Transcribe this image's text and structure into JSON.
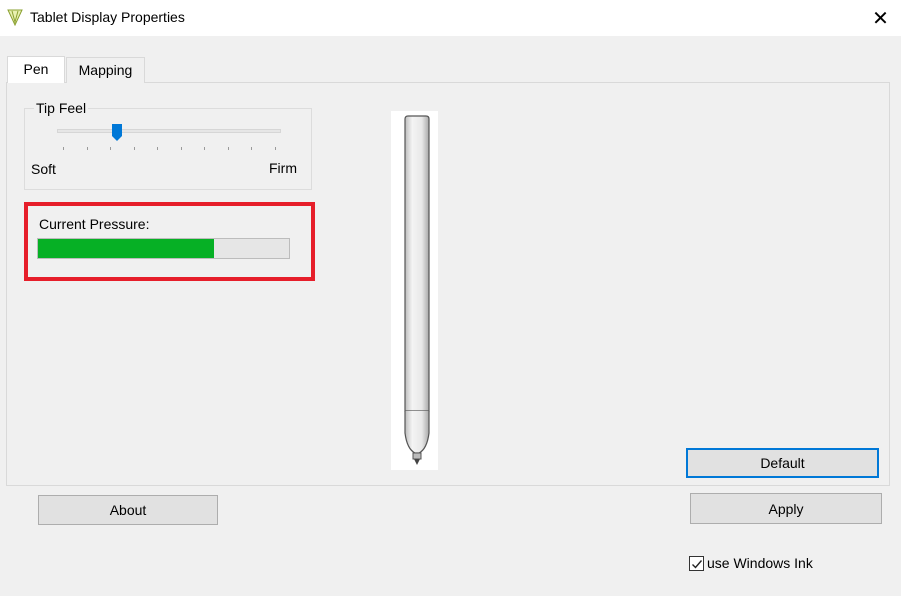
{
  "window": {
    "title": "Tablet Display Properties",
    "icon": "tablet-pen-app-icon",
    "close_glyph": "✕"
  },
  "tabs": [
    {
      "label": "Pen",
      "active": true
    },
    {
      "label": "Mapping",
      "active": false
    }
  ],
  "tip_feel": {
    "group_label": "Tip Feel",
    "min_label": "Soft",
    "max_label": "Firm",
    "slider_position_fraction": 0.27,
    "tick_count": 10
  },
  "pressure": {
    "label": "Current Pressure:",
    "value_fraction": 0.7,
    "fill_color": "#06b025"
  },
  "highlight_color": "#e61e2a",
  "buttons": {
    "default_label": "Default",
    "about_label": "About",
    "apply_label": "Apply"
  },
  "windows_ink": {
    "label": "use Windows Ink",
    "checked": true
  }
}
